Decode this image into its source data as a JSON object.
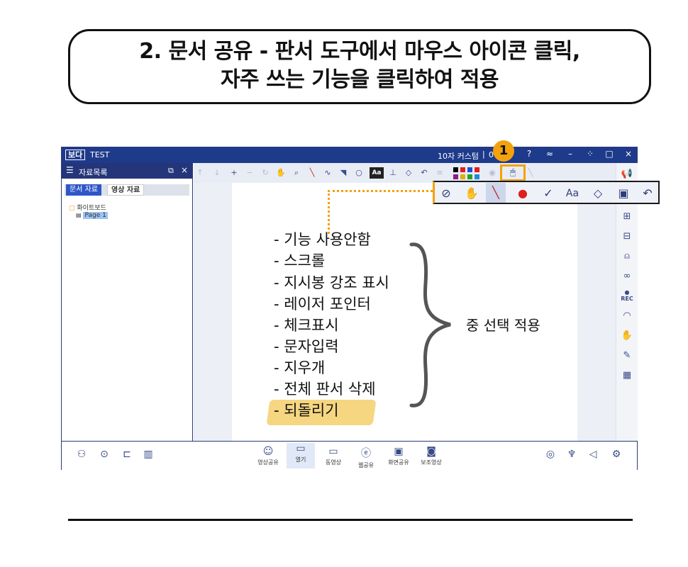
{
  "banner": {
    "line1": "2. 문서 공유 - 판서 도구에서 마우스 아이콘 클릭,",
    "line2": "자주 쓰는 기능을 클릭하여 적용"
  },
  "titlebar": {
    "logo": "보다",
    "title": "TEST",
    "custom": "10자 커스텀",
    "time": "0",
    "badge": "1"
  },
  "left_panel": {
    "header": "자료목록",
    "tabs": [
      "문서 자료",
      "영상 자료"
    ],
    "tree_root": "화이트보드",
    "tree_page": "Page 1"
  },
  "toolbar": {
    "font_button": "Aa"
  },
  "popup": {
    "font_button": "Aa"
  },
  "notes": {
    "items": [
      "- 기능 사용안함",
      "- 스크롤",
      "- 지시봉 강조 표시",
      "- 레이저 포인터",
      "- 체크표시",
      "- 문자입력",
      "- 지우개",
      "- 전체 판서 삭제",
      "- 되돌리기"
    ],
    "summary": "중 선택 적용"
  },
  "right_bar": {
    "rec_label": "REC"
  },
  "bottom_bar": {
    "labels": [
      "영상공유",
      "열기",
      "동영상",
      "웹공유",
      "화면공유",
      "보조영상"
    ]
  },
  "colors": {
    "title_bg": "#1e3a8a",
    "accent_orange": "#f2a20b",
    "highlight": "#f5cf6a",
    "laser_red": "#e11d1d"
  }
}
